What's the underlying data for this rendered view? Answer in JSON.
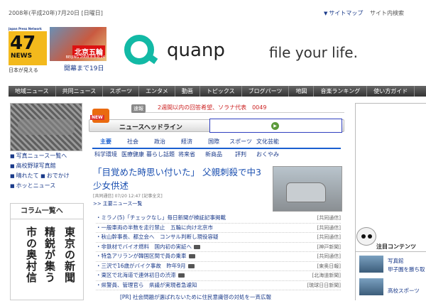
{
  "header": {
    "date": "2008年(平成20年)7月20日 [日曜日]",
    "sitemap": "サイトマップ",
    "site_search": "サイト内検索"
  },
  "logo": {
    "sub": "Japan Press Network",
    "number": "47",
    "word": "NEWS",
    "tagline": "日本が見える"
  },
  "olympic": {
    "title": "北京五輪",
    "dates": "BEIJING 2008.8.8-8.24",
    "countdown": "開幕まで19日"
  },
  "banner": {
    "brand": "quanp",
    "tagline": "file your life."
  },
  "nav": [
    "地域ニュース",
    "共同ニュース",
    "スポーツ",
    "エンタメ",
    "動画",
    "トピックス",
    "ブログパーツ",
    "地図",
    "音楽ランキング",
    "使い方ガイド"
  ],
  "left": {
    "links": [
      {
        "a": "写真ニュース一覧へ"
      },
      {
        "a": "高校野球写真館"
      },
      {
        "a": "晴れたて",
        "b": "おでかけ"
      },
      {
        "a": "ホッとニュース"
      }
    ],
    "column_head": "コラム一覧へ",
    "column_lines": [
      "東京の新聞",
      "精鋭が集う",
      "市の奥村信"
    ]
  },
  "center": {
    "flash_tag": "速報",
    "flash_text": "2週間以内の回答希望、ソラナ代表　0049",
    "new_label": "NEW",
    "headline_bar": "ニュースヘッドライン",
    "categories_row1": [
      "主要",
      "社会",
      "政治",
      "経済",
      "国際",
      "スポーツ",
      "文化芸能"
    ],
    "categories_row2": [
      "科学環境",
      "医療健康",
      "暮らし話題",
      "将来省",
      "新商品",
      "評判",
      "おくやみ"
    ],
    "topic_title": "「目覚めた時思い付いた」 父親刺殺で中3少女供述",
    "topic_meta": "[共同通信] 07/20 12:47 [記事全文]",
    "topic_more": "主要ニュース一覧",
    "items": [
      {
        "t": "・ミラノ(5)「チェックなし」毎日新聞が検証記事掲載",
        "s": "[共同通信]",
        "cam": false
      },
      {
        "t": "・一般車両の半数を走行禁止　五輪に向け北京市",
        "s": "[共同通信]",
        "cam": false
      },
      {
        "t": "・秋山幹事長、都立会へ　コンサル判断し現役容疑",
        "s": "[共同通信]",
        "cam": false
      },
      {
        "t": "・非鉄材でバイオ燃料　国内初の実証へ",
        "s": "[神戸新聞]",
        "cam": true
      },
      {
        "t": "・特急アリランが韓国区間で員の乗車",
        "s": "[共同通信]",
        "cam": true
      },
      {
        "t": "・三沢で16歳がバイク事故　昨年9月",
        "s": "[東奥日報]",
        "cam": true
      },
      {
        "t": "・東区で北海道で連休初日の渋滞",
        "s": "[北海道新聞]",
        "cam": true
      },
      {
        "t": "・県警員、管理官ら　県議が実現者急遽知",
        "s": "[琉球日日新聞]",
        "cam": false
      }
    ],
    "bottom_cut": "[PR] 社会問題が選ばれないために住民意識啓の対処を一斉広報"
  },
  "right": {
    "attention": "注目コンテンツ",
    "links": [
      "写真館",
      "甲子園を勝ち取",
      "高校スポーツ"
    ]
  }
}
